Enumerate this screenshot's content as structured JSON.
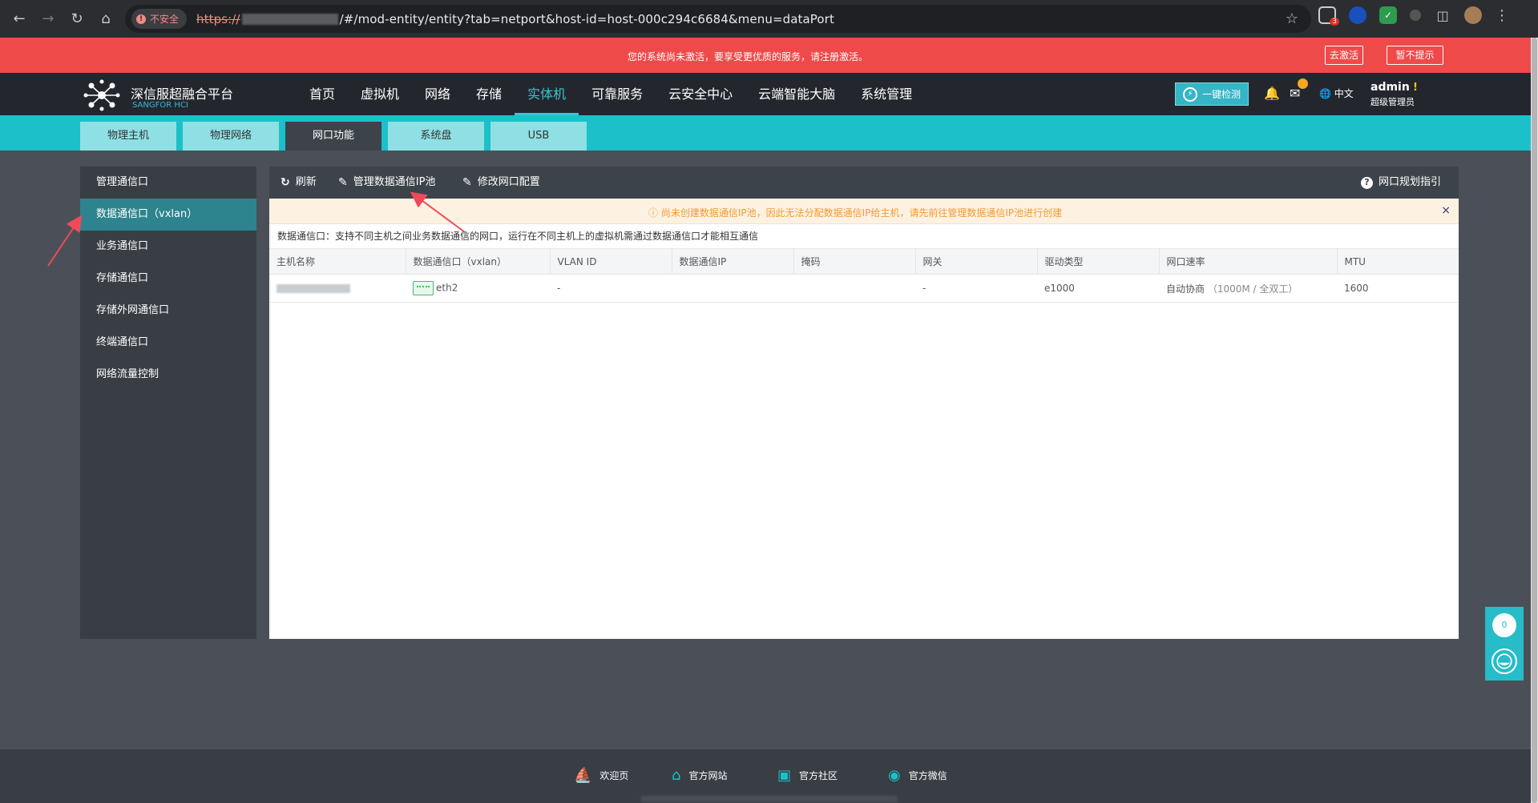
{
  "browser": {
    "insecure_label": "不安全",
    "url_scheme": "https://",
    "url_rest": "/#/mod-entity/entity?tab=netport&host-id=host-000c294c6684&menu=dataPort",
    "ext_badge": "3"
  },
  "banner": {
    "text": "您的系统尚未激活，要享受更优质的服务，请注册激活。",
    "activate_label": "去激活",
    "dismiss_label": "暂不提示"
  },
  "header": {
    "brand": "深信服超融合平台",
    "brand_sub": "SANGFOR HCI",
    "menu": [
      {
        "label": "首页"
      },
      {
        "label": "虚拟机"
      },
      {
        "label": "网络"
      },
      {
        "label": "存储"
      },
      {
        "label": "实体机"
      },
      {
        "label": "可靠服务"
      },
      {
        "label": "云安全中心"
      },
      {
        "label": "云端智能大脑"
      },
      {
        "label": "系统管理"
      }
    ],
    "check_label": "一键检测",
    "lang_label": "中文",
    "user_name": "admin",
    "user_warn": "!",
    "user_role": "超级管理员"
  },
  "subtabs": [
    {
      "label": "物理主机"
    },
    {
      "label": "物理网络"
    },
    {
      "label": "网口功能"
    },
    {
      "label": "系统盘"
    },
    {
      "label": "USB"
    }
  ],
  "sidebar": {
    "items": [
      {
        "label": "管理通信口"
      },
      {
        "label": "数据通信口（vxlan）"
      },
      {
        "label": "业务通信口"
      },
      {
        "label": "存储通信口"
      },
      {
        "label": "存储外网通信口"
      },
      {
        "label": "终端通信口"
      },
      {
        "label": "网络流量控制"
      }
    ]
  },
  "toolbar": {
    "refresh_label": "刷新",
    "manage_label": "管理数据通信IP池",
    "edit_label": "修改网口配置",
    "guide_label": "网口规划指引"
  },
  "notice": {
    "text": "尚未创建数据通信IP池，因此无法分配数据通信IP给主机，请先前往管理数据通信IP池进行创建",
    "close": "×"
  },
  "description": "数据通信口：支持不同主机之间业务数据通信的网口，运行在不同主机上的虚拟机需通过数据通信口才能相互通信",
  "table": {
    "headers": [
      "主机名称",
      "数据通信口（vxlan）",
      "VLAN ID",
      "数据通信IP",
      "掩码",
      "网关",
      "驱动类型",
      "网口速率",
      "MTU"
    ],
    "rows": [
      {
        "port": "eth2",
        "vlan": "-",
        "ip": "",
        "mask": "",
        "gateway": "-",
        "driver": "e1000",
        "speed": "自动协商",
        "speed_detail": "（1000M / 全双工）",
        "mtu": "1600"
      }
    ]
  },
  "float": {
    "count": "0"
  },
  "footer": {
    "links": [
      {
        "label": "欢迎页",
        "icon": "welcome-icon"
      },
      {
        "label": "官方网站",
        "icon": "home-icon"
      },
      {
        "label": "官方社区",
        "icon": "community-icon"
      },
      {
        "label": "官方微信",
        "icon": "wechat-icon"
      }
    ]
  },
  "colors": {
    "banner": "#ef4a4a",
    "accent": "#1cc0c8",
    "active_menu": "#37c5d3",
    "sidebar_active": "#2d848e",
    "notice": "#f29a32"
  }
}
